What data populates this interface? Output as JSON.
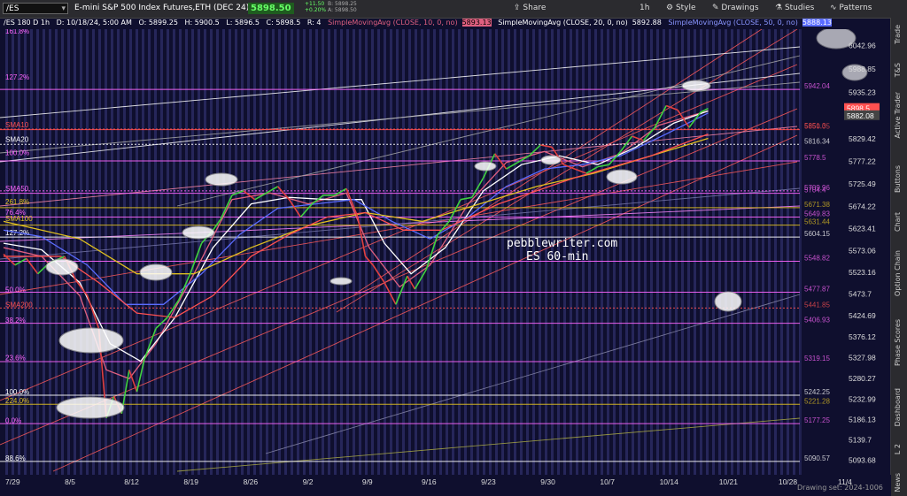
{
  "toolbar": {
    "symbol": "/ES",
    "full_name": "E-mini S&P 500 Index Futures,ETH (DEC 24)",
    "last_price": "5898.50",
    "change": "+11.50",
    "change_pct": "+0.20%",
    "bid": "B: 5898.25",
    "ask": "A: 5898.50",
    "share": "Share",
    "timeframe": "1h",
    "style": "Style",
    "drawings": "Drawings",
    "studies": "Studies",
    "patterns": "Patterns"
  },
  "info_line": {
    "period": "/ES 180 D 1h",
    "date": "D: 10/18/24, 5:00 AM",
    "open": "O: 5899.25",
    "high": "H: 5900.5",
    "low": "L: 5896.5",
    "close": "C: 5898.5",
    "range": "R: 4",
    "sma10": "SimpleMovingAvg (CLOSE, 10, 0, no)",
    "sma10_val": "5893.13",
    "sma20": "SimpleMovingAvg (CLOSE, 20, 0, no)",
    "sma20_val": "5892.88",
    "sma50": "SimpleMovingAvg (CLOSE, 50, 0, no)",
    "sma50_val": "5888.13"
  },
  "side_tabs": [
    "Trade",
    "T&S",
    "Active Trader",
    "Buttons",
    "Chart",
    "Option Chain",
    "Phase Scores",
    "Dashboard",
    "L 2",
    "News"
  ],
  "watermark": {
    "line1": "pebblewriter.com",
    "line2": "ES 60-min"
  },
  "footer": "Drawing set: 2024-1006",
  "colors": {
    "background": "#0f0f2e",
    "vertical_stripe": "#2a2a62",
    "price_up": "#3fd23f",
    "price_down": "#e24040",
    "sma10": "#e06080",
    "sma20": "#ffffff",
    "sma50": "#5a6cff",
    "sma100": "#e0c020",
    "sma200": "#ff5050",
    "fib": "#ff66ff",
    "level_white": "#ffffff",
    "channel": "#ff5a5a"
  },
  "chart_data": {
    "type": "line",
    "title": "",
    "ylim": [
      5060,
      6080
    ],
    "price_ticks": [
      "6042.96",
      "5988.85",
      "5935.23",
      "5882.08",
      "5829.42",
      "5777.22",
      "5725.49",
      "5674.22",
      "5623.41",
      "5573.06",
      "5523.16",
      "5473.7",
      "5424.69",
      "5376.12",
      "5327.98",
      "5280.27",
      "5232.99",
      "5186.13",
      "5139.7",
      "5093.68"
    ],
    "x_tick_labels": [
      "7/29",
      "8/5",
      "8/12",
      "8/19",
      "8/26",
      "9/2",
      "9/9",
      "9/16",
      "9/23",
      "9/30",
      "10/7",
      "10/14",
      "10/21",
      "10/28",
      "11/4"
    ],
    "price_path": [
      [
        0,
        5565
      ],
      [
        3,
        5540
      ],
      [
        6,
        5555
      ],
      [
        9,
        5520
      ],
      [
        12,
        5545
      ],
      [
        16,
        5560
      ],
      [
        19,
        5505
      ],
      [
        22,
        5470
      ],
      [
        25,
        5395
      ],
      [
        27,
        5190
      ],
      [
        29,
        5240
      ],
      [
        31,
        5200
      ],
      [
        33,
        5300
      ],
      [
        35,
        5250
      ],
      [
        37,
        5325
      ],
      [
        40,
        5395
      ],
      [
        43,
        5420
      ],
      [
        46,
        5460
      ],
      [
        49,
        5520
      ],
      [
        52,
        5590
      ],
      [
        55,
        5620
      ],
      [
        57,
        5645
      ],
      [
        60,
        5700
      ],
      [
        63,
        5710
      ],
      [
        66,
        5690
      ],
      [
        69,
        5705
      ],
      [
        72,
        5720
      ],
      [
        75,
        5690
      ],
      [
        78,
        5650
      ],
      [
        81,
        5680
      ],
      [
        84,
        5700
      ],
      [
        87,
        5700
      ],
      [
        90,
        5715
      ],
      [
        93,
        5650
      ],
      [
        95,
        5560
      ],
      [
        97,
        5540
      ],
      [
        100,
        5500
      ],
      [
        103,
        5450
      ],
      [
        106,
        5515
      ],
      [
        108,
        5485
      ],
      [
        111,
        5530
      ],
      [
        114,
        5610
      ],
      [
        117,
        5640
      ],
      [
        120,
        5690
      ],
      [
        123,
        5695
      ],
      [
        126,
        5740
      ],
      [
        129,
        5795
      ],
      [
        132,
        5760
      ],
      [
        135,
        5775
      ],
      [
        138,
        5790
      ],
      [
        141,
        5815
      ],
      [
        144,
        5810
      ],
      [
        147,
        5770
      ],
      [
        150,
        5760
      ],
      [
        153,
        5750
      ],
      [
        156,
        5765
      ],
      [
        159,
        5770
      ],
      [
        162,
        5800
      ],
      [
        165,
        5835
      ],
      [
        168,
        5825
      ],
      [
        171,
        5855
      ],
      [
        174,
        5905
      ],
      [
        177,
        5895
      ],
      [
        180,
        5855
      ],
      [
        183,
        5890
      ],
      [
        185,
        5898.5
      ]
    ],
    "sma_lines": [
      {
        "name": "SMA10",
        "color": "#e06080",
        "points": [
          [
            0,
            5580
          ],
          [
            10,
            5560
          ],
          [
            20,
            5470
          ],
          [
            27,
            5300
          ],
          [
            33,
            5280
          ],
          [
            40,
            5360
          ],
          [
            50,
            5520
          ],
          [
            60,
            5690
          ],
          [
            70,
            5705
          ],
          [
            80,
            5680
          ],
          [
            90,
            5705
          ],
          [
            96,
            5580
          ],
          [
            104,
            5490
          ],
          [
            112,
            5540
          ],
          [
            122,
            5680
          ],
          [
            132,
            5775
          ],
          [
            142,
            5800
          ],
          [
            152,
            5765
          ],
          [
            162,
            5795
          ],
          [
            172,
            5860
          ],
          [
            185,
            5893.13
          ]
        ]
      },
      {
        "name": "SMA20",
        "color": "#ffffff",
        "points": [
          [
            0,
            5590
          ],
          [
            10,
            5575
          ],
          [
            20,
            5500
          ],
          [
            28,
            5360
          ],
          [
            36,
            5320
          ],
          [
            45,
            5420
          ],
          [
            55,
            5580
          ],
          [
            65,
            5680
          ],
          [
            75,
            5695
          ],
          [
            85,
            5690
          ],
          [
            94,
            5690
          ],
          [
            100,
            5590
          ],
          [
            107,
            5520
          ],
          [
            116,
            5580
          ],
          [
            126,
            5710
          ],
          [
            136,
            5770
          ],
          [
            146,
            5790
          ],
          [
            156,
            5770
          ],
          [
            166,
            5810
          ],
          [
            176,
            5865
          ],
          [
            185,
            5892.88
          ]
        ]
      },
      {
        "name": "SMA50",
        "color": "#5a6cff",
        "points": [
          [
            0,
            5620
          ],
          [
            10,
            5605
          ],
          [
            22,
            5540
          ],
          [
            32,
            5450
          ],
          [
            42,
            5450
          ],
          [
            52,
            5520
          ],
          [
            62,
            5610
          ],
          [
            72,
            5670
          ],
          [
            82,
            5680
          ],
          [
            92,
            5690
          ],
          [
            102,
            5640
          ],
          [
            112,
            5600
          ],
          [
            122,
            5650
          ],
          [
            132,
            5720
          ],
          [
            142,
            5760
          ],
          [
            152,
            5770
          ],
          [
            162,
            5790
          ],
          [
            174,
            5840
          ],
          [
            185,
            5888.13
          ]
        ]
      },
      {
        "name": "SMA100",
        "color": "#e0c020",
        "points": [
          [
            0,
            5640
          ],
          [
            20,
            5600
          ],
          [
            35,
            5520
          ],
          [
            50,
            5520
          ],
          [
            65,
            5580
          ],
          [
            80,
            5630
          ],
          [
            95,
            5660
          ],
          [
            110,
            5640
          ],
          [
            125,
            5680
          ],
          [
            140,
            5720
          ],
          [
            155,
            5750
          ],
          [
            170,
            5790
          ],
          [
            185,
            5830
          ]
        ]
      },
      {
        "name": "SMA200",
        "color": "#ff5050",
        "points": [
          [
            0,
            5560
          ],
          [
            15,
            5560
          ],
          [
            25,
            5500
          ],
          [
            35,
            5430
          ],
          [
            45,
            5420
          ],
          [
            55,
            5470
          ],
          [
            65,
            5560
          ],
          [
            75,
            5610
          ],
          [
            85,
            5650
          ],
          [
            95,
            5660
          ],
          [
            105,
            5620
          ],
          [
            115,
            5620
          ],
          [
            130,
            5680
          ],
          [
            150,
            5740
          ],
          [
            170,
            5790
          ],
          [
            185,
            5840
          ]
        ]
      }
    ],
    "horizontal_levels": [
      {
        "label": "5942.04",
        "value": 5942.04,
        "color": "#ff66ff",
        "style": "solid"
      },
      {
        "label": "5851.3",
        "value": 5851.3,
        "color": "#ff5050",
        "style": "dotted"
      },
      {
        "label": "5850.05",
        "value": 5850.05,
        "color": "#ff5050",
        "style": "solid"
      },
      {
        "label": "5816.34",
        "value": 5816.34,
        "color": "#ffffff",
        "style": "dotted"
      },
      {
        "label": "5778.5",
        "value": 5778.5,
        "color": "#ff66ff",
        "style": "solid"
      },
      {
        "label": "5709.96",
        "value": 5709.96,
        "color": "#ff66ff",
        "style": "dotted"
      },
      {
        "label": "5704.4",
        "value": 5704.4,
        "color": "#ff66ff",
        "style": "solid"
      },
      {
        "label": "5671.38",
        "value": 5671.38,
        "color": "#e0c020",
        "style": "solid"
      },
      {
        "label": "5649.83",
        "value": 5649.83,
        "color": "#ff66ff",
        "style": "solid"
      },
      {
        "label": "5631.44",
        "value": 5631.44,
        "color": "#e0c020",
        "style": "solid"
      },
      {
        "label": "5604.15",
        "value": 5604.15,
        "color": "#ffffff",
        "style": "solid"
      },
      {
        "label": "5548.82",
        "value": 5548.82,
        "color": "#ff66ff",
        "style": "solid"
      },
      {
        "label": "5477.87",
        "value": 5477.87,
        "color": "#ff66ff",
        "style": "solid"
      },
      {
        "label": "5441.85",
        "value": 5441.85,
        "color": "#ff5050",
        "style": "dotted"
      },
      {
        "label": "5406.93",
        "value": 5406.93,
        "color": "#ff66ff",
        "style": "solid"
      },
      {
        "label": "5319.15",
        "value": 5319.15,
        "color": "#ff66ff",
        "style": "solid"
      },
      {
        "label": "5242.25",
        "value": 5242.25,
        "color": "#ffffff",
        "style": "solid"
      },
      {
        "label": "5221.28",
        "value": 5221.28,
        "color": "#e0c020",
        "style": "solid"
      },
      {
        "label": "5177.25",
        "value": 5177.25,
        "color": "#ff66ff",
        "style": "solid"
      },
      {
        "label": "5090.57",
        "value": 5090.57,
        "color": "#ffffff",
        "style": "solid"
      }
    ],
    "left_labels": [
      {
        "text": "161.8%",
        "value": 6070,
        "color": "#ff66ff"
      },
      {
        "text": "127.2%",
        "value": 5965,
        "color": "#ff66ff"
      },
      {
        "text": "SMA10",
        "value": 5855,
        "color": "#ff5050"
      },
      {
        "text": "SMA20",
        "value": 5822,
        "color": "#ffffff"
      },
      {
        "text": "100.0%",
        "value": 5792,
        "color": "#ff66ff"
      },
      {
        "text": "SMA50",
        "value": 5710,
        "color": "#ff66ff"
      },
      {
        "text": "261.8%",
        "value": 5679,
        "color": "#e0c020"
      },
      {
        "text": "76.4%",
        "value": 5655,
        "color": "#ff66ff"
      },
      {
        "text": "SMA100",
        "value": 5641,
        "color": "#e0c020"
      },
      {
        "text": "127.2%",
        "value": 5608,
        "color": "#ffffff"
      },
      {
        "text": "50.0%",
        "value": 5478,
        "color": "#ff66ff"
      },
      {
        "text": "SMA200",
        "value": 5444,
        "color": "#ff5050"
      },
      {
        "text": "38.2%",
        "value": 5408,
        "color": "#ff66ff"
      },
      {
        "text": "23.6%",
        "value": 5322,
        "color": "#ff66ff"
      },
      {
        "text": "100.0%",
        "value": 5244,
        "color": "#ffffff"
      },
      {
        "text": "224.0%",
        "value": 5224,
        "color": "#e0c020"
      },
      {
        "text": "0.0%",
        "value": 5178,
        "color": "#ff66ff"
      },
      {
        "text": "88.6%",
        "value": 5092,
        "color": "#ffffff"
      }
    ],
    "price_badges": [
      {
        "label": "5898.5",
        "value": 5898.5,
        "color": "#ff5050"
      },
      {
        "label": "5882.08",
        "value": 5882.08,
        "color": "#444"
      }
    ],
    "grid": true
  }
}
